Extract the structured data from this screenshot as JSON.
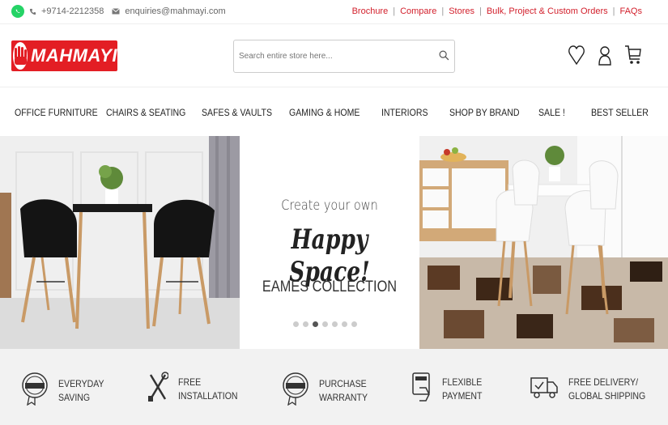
{
  "topbar": {
    "phone": "+9714-2212358",
    "email": "enquiries@mahmayi.com",
    "links": [
      "Brochure",
      "Compare",
      "Stores",
      "Bulk, Project & Custom Orders",
      "FAQs"
    ]
  },
  "header": {
    "logo_text": "MAHMAYI",
    "search_placeholder": "Search entire store here..."
  },
  "nav": {
    "items": [
      "OFFICE FURNITURE",
      "CHAIRS & SEATING",
      "SAFES & VAULTS",
      "GAMING & HOME",
      "INTERIORS",
      "SHOP BY BRAND",
      "SALE !",
      "BEST SELLER"
    ]
  },
  "banner": {
    "line1": "Create your own",
    "line2": "Happy Space!",
    "line3": "EAMES COLLECTION",
    "slide_count": 7,
    "active_slide": 3
  },
  "features": [
    {
      "line1": "EVERYDAY",
      "line2": "SAVING",
      "icon": "badge-icon"
    },
    {
      "line1": "FREE",
      "line2": "INSTALLATION",
      "icon": "tools-icon"
    },
    {
      "line1": "PURCHASE",
      "line2": "WARRANTY",
      "icon": "warranty-icon"
    },
    {
      "line1": "FLEXIBLE",
      "line2": "PAYMENT",
      "icon": "card-payment-icon"
    },
    {
      "line1": "FREE DELIVERY/",
      "line2": "GLOBAL SHIPPING",
      "icon": "delivery-truck-icon"
    }
  ],
  "colors": {
    "brand_red": "#e31e24",
    "link_red": "#d21f2b",
    "whatsapp_green": "#25d366"
  }
}
